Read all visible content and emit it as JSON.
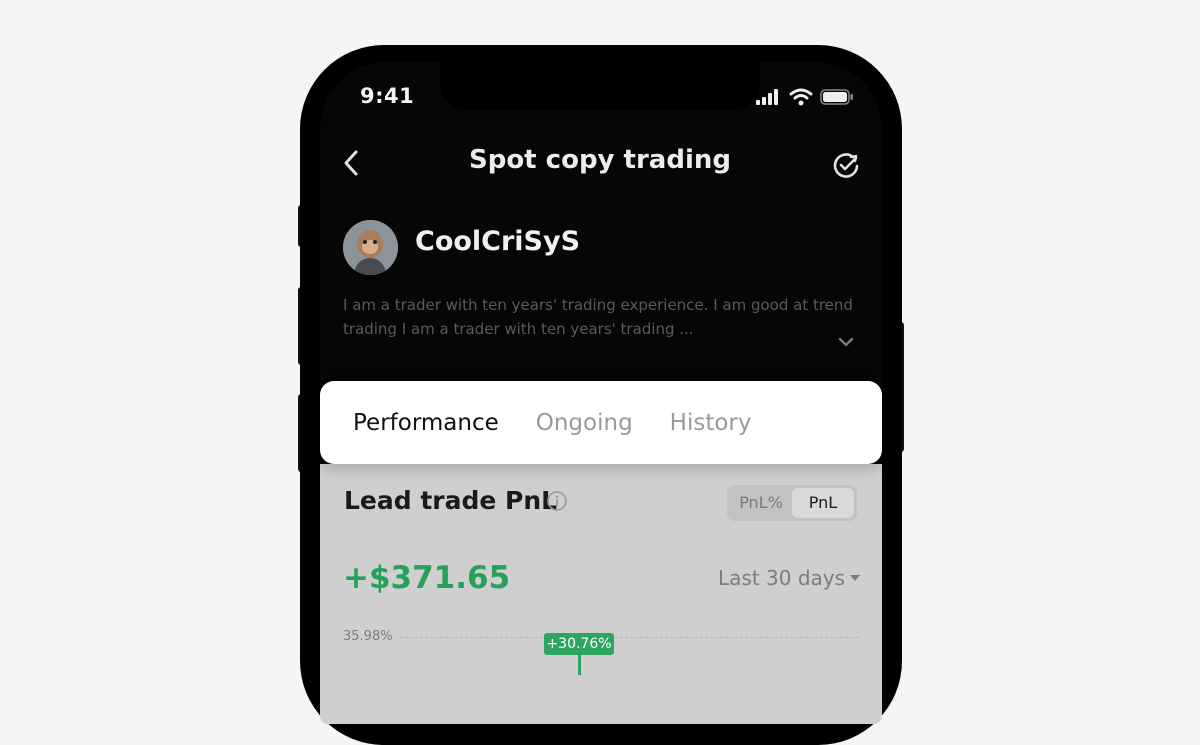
{
  "status_bar": {
    "time": "9:41"
  },
  "nav": {
    "title": "Spot copy trading"
  },
  "trader": {
    "name": "CoolCriSyS",
    "bio": "I am a trader with ten years' trading experience. I am good at trend trading I am a trader with ten years' trading ..."
  },
  "tabs": [
    {
      "label": "Performance",
      "active": true
    },
    {
      "label": "Ongoing",
      "active": false
    },
    {
      "label": "History",
      "active": false
    }
  ],
  "lead_trade": {
    "title": "Lead trade PnL",
    "toggle": {
      "options": [
        "PnL%",
        "PnL"
      ],
      "selected": "PnL"
    },
    "value": "+$371.65",
    "period": "Last 30 days",
    "chart": {
      "y_top_label": "35.98%",
      "tooltip": "+30.76%"
    }
  },
  "colors": {
    "positive": "#28a05a",
    "background": "#060606",
    "card": "#ffffff"
  }
}
